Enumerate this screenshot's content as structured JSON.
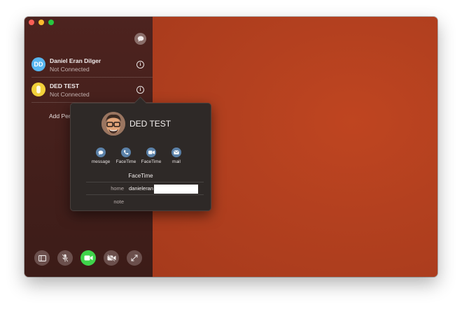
{
  "contacts": [
    {
      "initials": "DD",
      "name": "Daniel Eran Dilger",
      "status": "Not Connected"
    },
    {
      "name": "DED TEST",
      "status": "Not Connected"
    }
  ],
  "sidebar": {
    "add_person": "Add Pers",
    "info_glyph": "i"
  },
  "popover": {
    "name": "DED TEST",
    "actions": [
      {
        "icon": "message-icon",
        "label": "message"
      },
      {
        "icon": "phone-icon",
        "label": "FaceTime"
      },
      {
        "icon": "video-icon",
        "label": "FaceTime"
      },
      {
        "icon": "mail-icon",
        "label": "mail"
      }
    ],
    "section_title": "FaceTime",
    "rows": [
      {
        "label": "home",
        "value": "danieleran"
      },
      {
        "label": "note",
        "value": ""
      }
    ]
  },
  "toolbar": {
    "buttons": [
      "sidebar-toggle-icon",
      "mute-mic-icon",
      "camera-on-icon",
      "camera-off-icon",
      "fullscreen-icon"
    ]
  },
  "colors": {
    "camera_bg": "#b8401f",
    "sidebar_bg": "#44201c",
    "accent_green": "#3fd34a",
    "action_blue": "#5b81a8"
  }
}
